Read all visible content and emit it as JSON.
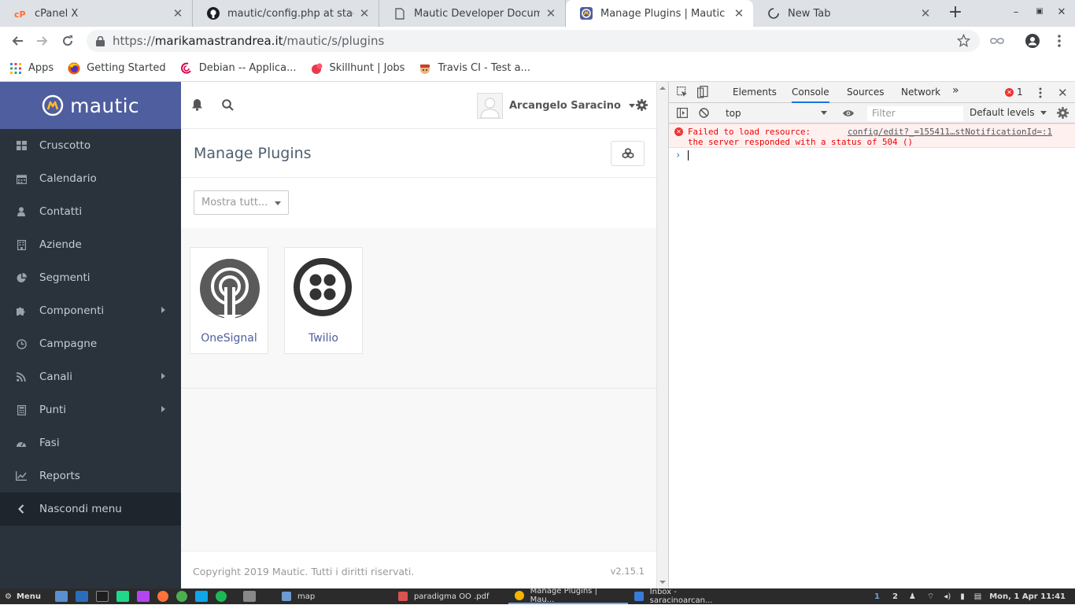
{
  "browser": {
    "tabs": [
      {
        "title": "cPanel X",
        "icon": "cpanel-icon",
        "active": false
      },
      {
        "title": "mautic/config.php at staging",
        "icon": "github-icon",
        "active": false
      },
      {
        "title": "Mautic Developer Documentation",
        "icon": "document-icon",
        "active": false
      },
      {
        "title": "Manage Plugins | Mautic",
        "icon": "mautic-icon",
        "active": true
      },
      {
        "title": "New Tab",
        "icon": "loading-icon",
        "active": false
      }
    ],
    "url_scheme": "https://",
    "url_host": "marikamastrandrea.it",
    "url_path": "/mautic/s/plugins",
    "bookmarks": [
      {
        "label": "Apps",
        "icon": "apps-grid-icon"
      },
      {
        "label": "Getting Started",
        "icon": "firefox-icon"
      },
      {
        "label": "Debian -- Applica...",
        "icon": "debian-icon"
      },
      {
        "label": "Skillhunt | Jobs",
        "icon": "skillhunt-icon"
      },
      {
        "label": "Travis CI - Test a...",
        "icon": "travis-icon"
      }
    ]
  },
  "mautic": {
    "logo_text": "mautic",
    "user_name": "Arcangelo Saracino",
    "nav": [
      {
        "label": "Cruscotto",
        "icon": "dashboard-icon",
        "submenu": false
      },
      {
        "label": "Calendario",
        "icon": "calendar-icon",
        "submenu": false
      },
      {
        "label": "Contatti",
        "icon": "user-icon",
        "submenu": false
      },
      {
        "label": "Aziende",
        "icon": "building-icon",
        "submenu": false
      },
      {
        "label": "Segmenti",
        "icon": "pie-chart-icon",
        "submenu": false
      },
      {
        "label": "Componenti",
        "icon": "puzzle-icon",
        "submenu": true
      },
      {
        "label": "Campagne",
        "icon": "clock-icon",
        "submenu": false
      },
      {
        "label": "Canali",
        "icon": "rss-icon",
        "submenu": true
      },
      {
        "label": "Punti",
        "icon": "calculator-icon",
        "submenu": true
      },
      {
        "label": "Fasi",
        "icon": "tachometer-icon",
        "submenu": false
      },
      {
        "label": "Reports",
        "icon": "line-chart-icon",
        "submenu": false
      }
    ],
    "hide_menu_label": "Nascondi menu",
    "page_title": "Manage Plugins",
    "filter_value": "Mostra tutt...",
    "plugins": [
      {
        "name": "OneSignal",
        "icon": "onesignal-icon"
      },
      {
        "name": "Twilio",
        "icon": "twilio-icon"
      }
    ],
    "footer_copyright": "Copyright 2019 Mautic. Tutti i diritti riservati.",
    "footer_version": "v2.15.1"
  },
  "devtools": {
    "tabs": [
      "Elements",
      "Console",
      "Sources",
      "Network"
    ],
    "active_tab": "Console",
    "more_tabs": "»",
    "error_count": "1",
    "context": "top",
    "filter_placeholder": "Filter",
    "levels": "Default levels",
    "error_line1": "Failed to load resource:",
    "error_line2": "the server responded with a status of 504 ()",
    "error_source": "config/edit?_=155411…stNotificationId=:1",
    "prompt_symbol": "›"
  },
  "taskbar": {
    "menu_label": "Menu",
    "tasks": [
      {
        "label": "map",
        "icon": "folder-icon"
      },
      {
        "label": "paradigma OO .pdf",
        "icon": "pdf-icon"
      },
      {
        "label": "Manage Plugins | Mau...",
        "icon": "chrome-icon"
      },
      {
        "label": "Inbox - saracinoarcan...",
        "icon": "thunderbird-icon"
      }
    ],
    "workspace_1": "1",
    "workspace_2": "2",
    "clock": "Mon, 1 Apr 11:41"
  }
}
